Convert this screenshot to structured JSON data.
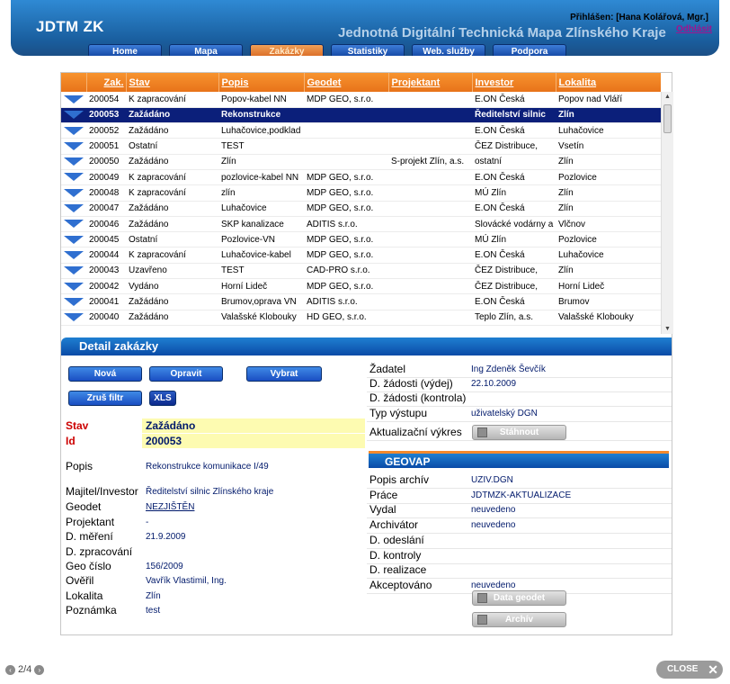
{
  "header": {
    "logo": "JDTM ZK",
    "tagline": "Jednotná Digitální Technická Mapa Zlínského Kraje",
    "login": "Přihlášen: [Hana Kolářová, Mgr.]",
    "logout": "Odhlásit"
  },
  "nav": [
    "Home",
    "Mapa",
    "Zakázky",
    "Statistiky",
    "Web. služby",
    "Podpora"
  ],
  "table": {
    "columns": [
      "Zak.",
      "Stav",
      "Popis",
      "Geodet",
      "Projektant",
      "Investor",
      "Lokalita"
    ],
    "rows": [
      [
        "200054",
        "K zapracování",
        "Popov-kabel NN",
        "MDP GEO, s.r.o.",
        "",
        "E.ON Česká",
        "Popov nad Vláří"
      ],
      [
        "200053",
        "Zažádáno",
        "Rekonstrukce",
        "",
        "",
        "Ředitelství silnic",
        "Zlín"
      ],
      [
        "200052",
        "Zažádáno",
        "Luhačovice,podklad",
        "",
        "",
        "E.ON Česká",
        "Luhačovice"
      ],
      [
        "200051",
        "Ostatní",
        "TEST",
        "",
        "",
        "ČEZ Distribuce,",
        "Vsetín"
      ],
      [
        "200050",
        "Zažádáno",
        "Zlín",
        "",
        "S-projekt Zlín, a.s.",
        "ostatní",
        "Zlín"
      ],
      [
        "200049",
        "K zapracování",
        "pozlovice-kabel NN",
        "MDP GEO, s.r.o.",
        "",
        "E.ON Česká",
        "Pozlovice"
      ],
      [
        "200048",
        "K zapracování",
        "zlín",
        "MDP GEO, s.r.o.",
        "",
        "MÚ Zlín",
        "Zlín"
      ],
      [
        "200047",
        "Zažádáno",
        "Luhačovice",
        "MDP GEO, s.r.o.",
        "",
        "E.ON Česká",
        "Zlín"
      ],
      [
        "200046",
        "Zažádáno",
        "SKP kanalizace",
        "ADITIS s.r.o.",
        "",
        "Slovácké vodárny a",
        "Vlčnov"
      ],
      [
        "200045",
        "Ostatní",
        "Pozlovice-VN",
        "MDP GEO, s.r.o.",
        "",
        "MÚ Zlín",
        "Pozlovice"
      ],
      [
        "200044",
        "K zapracování",
        "Luhačovice-kabel",
        "MDP GEO, s.r.o.",
        "",
        "E.ON Česká",
        "Luhačovice"
      ],
      [
        "200043",
        "Uzavřeno",
        "TEST",
        "CAD-PRO s.r.o.",
        "",
        "ČEZ Distribuce,",
        "Zlín"
      ],
      [
        "200042",
        "Vydáno",
        "Horní Lideč",
        "MDP GEO, s.r.o.",
        "",
        "ČEZ Distribuce,",
        "Horní Lideč"
      ],
      [
        "200041",
        "Zažádáno",
        "Brumov,oprava VN",
        "ADITIS s.r.o.",
        "",
        "E.ON Česká",
        "Brumov"
      ],
      [
        "200040",
        "Zažádáno",
        "Valašské Klobouky",
        "HD GEO, s.r.o.",
        "",
        "Teplo Zlín, a.s.",
        "Valašské Klobouky"
      ]
    ]
  },
  "detail": {
    "title": "Detail zakázky",
    "buttons": {
      "nova": "Nová",
      "opravit": "Opravit",
      "vybrat": "Vybrat",
      "zrus_filtr": "Zruš filtr",
      "xls": "XLS"
    },
    "stav_label": "Stav",
    "stav_value": "Zažádáno",
    "id_label": "Id",
    "id_value": "200053",
    "fields": [
      {
        "label": "Popis",
        "value": "Rekonstrukce komunikace I/49"
      },
      {
        "label": "Majitel/Investor",
        "value": "Ředitelství silnic Zlínského kraje"
      },
      {
        "label": "Geodet",
        "value": "NEZJIŠTĚN"
      },
      {
        "label": "Projektant",
        "value": "-"
      },
      {
        "label": "D. měření",
        "value": "21.9.2009"
      },
      {
        "label": "D. zpracování",
        "value": ""
      },
      {
        "label": "Geo číslo",
        "value": "156/2009"
      },
      {
        "label": "Ověřil",
        "value": "Vavřík Vlastimil, Ing."
      },
      {
        "label": "Lokalita",
        "value": "Zlín"
      },
      {
        "label": "Poznámka",
        "value": "test"
      }
    ],
    "right_fields": [
      {
        "label": "Žadatel",
        "value": "Ing Zdeněk Ševčík"
      },
      {
        "label": "D. žádosti (výdej)",
        "value": "22.10.2009"
      },
      {
        "label": "D. žádosti (kontrola)",
        "value": ""
      },
      {
        "label": "Typ výstupu",
        "value": "uživatelský DGN"
      },
      {
        "label": "Aktualizační výkres",
        "value": ""
      }
    ],
    "stahnout": "Stáhnout",
    "geovap_title": "GEOVAP",
    "geovap_fields": [
      {
        "label": "Popis archív",
        "value": "UZIV.DGN"
      },
      {
        "label": "Práce",
        "value": "JDTMZK-AKTUALIZACE"
      },
      {
        "label": "Vydal",
        "value": "neuvedeno"
      },
      {
        "label": "Archivátor",
        "value": "neuvedeno"
      },
      {
        "label": "D. odeslání",
        "value": ""
      },
      {
        "label": "D. kontroly",
        "value": ""
      },
      {
        "label": "D. realizace",
        "value": ""
      },
      {
        "label": "Akceptováno",
        "value": "neuvedeno"
      }
    ],
    "data_geodet": "Data geodet",
    "archiv": "Archív"
  },
  "footer": {
    "pager": "2/4",
    "close": "CLOSE"
  },
  "colors": {
    "header": "#1a5fa0",
    "table_header": "#f7932e",
    "selected_row": "#0b1f7a",
    "accent_orange": "#d7641f"
  }
}
